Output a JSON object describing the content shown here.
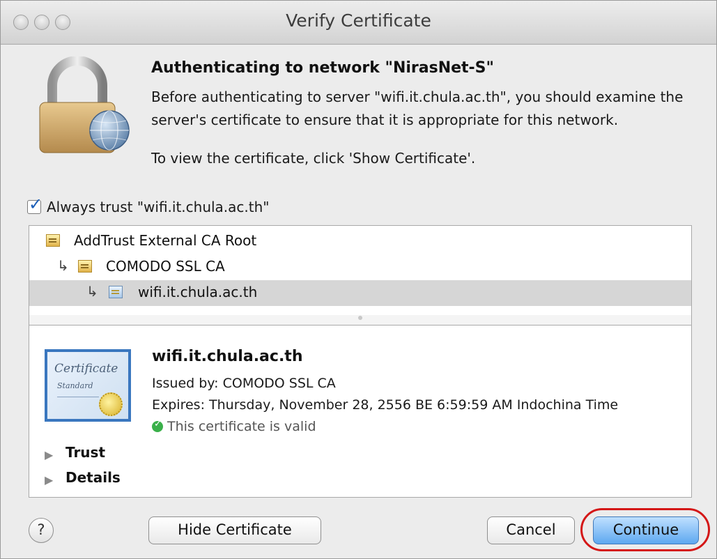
{
  "window": {
    "title": "Verify Certificate"
  },
  "header": {
    "heading": "Authenticating to network \"NirasNet-S\"",
    "paragraph_lines": [
      "Before authenticating to server \"wifi.it.chula.ac.th\", you should examine the",
      "server's certificate to ensure that it is appropriate for this network."
    ],
    "instruction": "To view the certificate, click 'Show Certificate'."
  },
  "trust_checkbox": {
    "label": "Always trust \"wifi.it.chula.ac.th\"",
    "checked": true
  },
  "certificate_chain": [
    {
      "label": "AddTrust External CA Root",
      "selected": false
    },
    {
      "label": "COMODO SSL CA",
      "selected": false
    },
    {
      "label": "wifi.it.chula.ac.th",
      "selected": true
    }
  ],
  "certificate": {
    "badge_line1": "Certificate",
    "badge_line2": "Standard",
    "name": "wifi.it.chula.ac.th",
    "issued_by": "Issued by: COMODO SSL CA",
    "expires": "Expires: Thursday, November 28, 2556 BE 6:59:59 AM Indochina Time",
    "status": "This certificate is valid",
    "status_color": "#3ab04a"
  },
  "sections": {
    "trust": "Trust",
    "details": "Details"
  },
  "buttons": {
    "help": "?",
    "hide_certificate": "Hide Certificate",
    "cancel": "Cancel",
    "continue": "Continue"
  },
  "colors": {
    "accent": "#5ea8f0",
    "annotation": "#d41717"
  }
}
